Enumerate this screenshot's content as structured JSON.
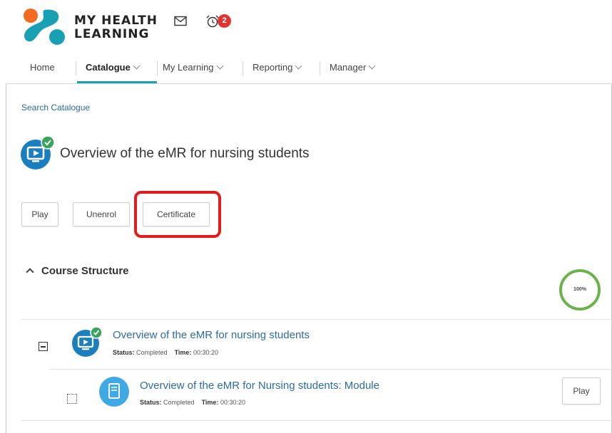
{
  "header": {
    "brand_line1": "MY HEALTH",
    "brand_line2": "LEARNING",
    "notification_count": "2",
    "logo_colors": [
      "#f26b21",
      "#1aa0b5"
    ]
  },
  "nav": {
    "items": [
      {
        "label": "Home",
        "dropdown": false
      },
      {
        "label": "Catalogue",
        "dropdown": true,
        "active": true
      },
      {
        "label": "My Learning",
        "dropdown": true
      },
      {
        "label": "Reporting",
        "dropdown": true
      },
      {
        "label": "Manager",
        "dropdown": true
      }
    ],
    "accent_color": "#1aa0b5"
  },
  "breadcrumb": "Search Catalogue",
  "course": {
    "title": "Overview of the eMR for nursing students",
    "buttons": {
      "play": "Play",
      "unenrol": "Unenrol",
      "certificate": "Certificate"
    }
  },
  "structure": {
    "heading": "Course Structure",
    "progress_label": "100%",
    "progress_fraction": 1.0,
    "items": [
      {
        "title": "Overview of the eMR for nursing students",
        "status_label": "Status:",
        "status_value": "Completed",
        "time_label": "Time:",
        "time_value": "00:30:20"
      },
      {
        "title": "Overview of the eMR for Nursing students: Module",
        "status_label": "Status:",
        "status_value": "Completed",
        "time_label": "Time:",
        "time_value": "00:30:20",
        "play_label": "Play"
      }
    ]
  },
  "colors": {
    "highlight": "#e41b1b",
    "progress_ring": "#6bb34a",
    "link": "#2b6ca3",
    "course_icon": "#1b7fbf",
    "module_icon": "#3fa9e6",
    "complete_check": "#3aa35c"
  }
}
